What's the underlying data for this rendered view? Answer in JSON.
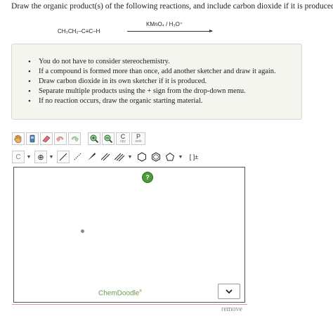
{
  "question": {
    "text": "Draw the organic product(s) of the following reactions, and include carbon dioxide if it is produced."
  },
  "reaction": {
    "reactant": "CH₃CH₂–C≡C–H",
    "reagent": "KMnO₄ / H₃O⁺"
  },
  "instructions": [
    "You do not have to consider stereochemistry.",
    "If a compound is formed more than once, add another sketcher and draw it again.",
    "Draw carbon dioxide in its own sketcher if it is produced.",
    "Separate multiple products using the + sign from the drop-down menu.",
    "If no reaction occurs, draw the organic starting material."
  ],
  "toolbar": {
    "copy_letter": "C",
    "copy_label": "opy",
    "paste_letter": "P",
    "paste_label": "aste",
    "element_label": "C",
    "charge_label": "⊕",
    "bracket_label": "[ ]±"
  },
  "canvas": {
    "help_label": "?",
    "brand": "ChemDoodle",
    "brand_mark": "®"
  },
  "footer": {
    "remove_label": "remove"
  },
  "colors": {
    "panel_bg": "#f4f5ef",
    "brand_green": "#6a9a4a",
    "help_green": "#4c9a3c"
  }
}
